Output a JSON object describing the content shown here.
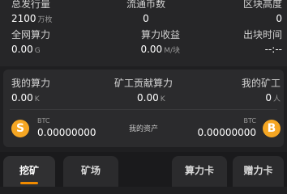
{
  "stats": {
    "total_supply": {
      "label": "总发行量",
      "value": "2100",
      "unit": "万枚"
    },
    "circulating": {
      "label": "流通币数",
      "value": "0"
    },
    "block_height": {
      "label": "区块高度",
      "value": "0"
    },
    "network_power": {
      "label": "全网算力",
      "value": "0.00",
      "unit": "G"
    },
    "power_income": {
      "label": "算力收益",
      "value": "0.00",
      "unit": "M/块"
    },
    "block_time": {
      "label": "出块时间",
      "value": "--:--"
    }
  },
  "power": {
    "my_power": {
      "label": "我的算力",
      "value": "0.00",
      "unit": "K"
    },
    "miner_contribution": {
      "label": "矿工贡献算力",
      "value": "0.00",
      "unit": "K"
    },
    "my_miners": {
      "label": "我的矿工",
      "value": "0",
      "unit": "人"
    },
    "assets_label": "我的资产",
    "left_coin": {
      "symbol": "S",
      "label": "BTC",
      "value": "0.00000000"
    },
    "right_coin": {
      "symbol": "B",
      "label": "BTC",
      "value": "0.00000000"
    }
  },
  "tabs": [
    {
      "label": "挖矿",
      "active": true
    },
    {
      "label": "矿场",
      "active": false
    },
    {
      "label": "算力卡",
      "active": false
    },
    {
      "label": "赠力卡",
      "active": false
    }
  ],
  "colors": {
    "accent": "#f08a00",
    "coin": "#f5a623"
  }
}
